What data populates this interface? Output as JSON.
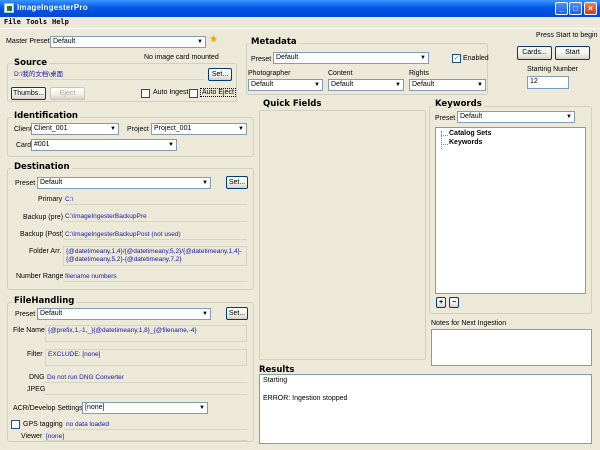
{
  "window": {
    "title": "ImageIngesterPro",
    "controls": {
      "minimize": "_",
      "maximize": "□",
      "close": "×"
    }
  },
  "menu": [
    "File",
    "Tools",
    "Help"
  ],
  "master_preset": {
    "label": "Master Preset",
    "value": "Default"
  },
  "source": {
    "header": "Source",
    "no_card_status": "No image card mounted",
    "path": "D:\\我的文档\\桌面",
    "set_button": "Set...",
    "thumbs_button": "Thumbs...",
    "eject_button": "Eject",
    "auto_ingest_label": "Auto Ingest",
    "auto_eject_label": "Auto Eject"
  },
  "identification": {
    "header": "Identification",
    "client_label": "Client",
    "client_value": "Client_001",
    "project_label": "Project",
    "project_value": "Project_001",
    "card_label": "Card",
    "card_value": "#001"
  },
  "destination": {
    "header": "Destination",
    "preset_label": "Preset",
    "preset_value": "Default",
    "set_button": "Set...",
    "primary_label": "Primary",
    "primary_value": "C:\\",
    "backup_pre_label": "Backup (pre)",
    "backup_pre_value": "C:\\ImageIngesterBackupPre",
    "backup_post_label": "Backup (Post)",
    "backup_post_value": "C:\\ImageIngesterBackupPost (not used)",
    "folder_arr_label": "Folder Arr.",
    "folder_arr_value": "{@datetimeany,1,4}/{@datetimeany,5,2}/{@datetimeany,1,4}-{@datetimeany,5,2}-{@datetimeany,7,2}",
    "number_range_label": "Number Range",
    "number_range_value": "filename numbers"
  },
  "file_handling": {
    "header": "FileHandling",
    "preset_label": "Preset",
    "preset_value": "Default",
    "set_button": "Set...",
    "file_name_label": "File Name",
    "file_name_value": "{@prefix,1,-1,_}{@datetimeany,1,8}_{@filename,-4}",
    "filter_label": "Filter",
    "filter_value": "EXCLUDE: [none]",
    "dng_label": "DNG",
    "dng_value": "Do not run DNG Converter",
    "jpeg_label": "JPEG",
    "jpeg_value": "",
    "acr_label": "ACR/Develop Settings",
    "acr_value": "[none]",
    "gps_label": "GPS tagging",
    "gps_value": "no data loaded",
    "viewer_label": "Viewer",
    "viewer_value": "[none]"
  },
  "metadata": {
    "header": "Metadata",
    "preset_label": "Preset",
    "preset_value": "Default",
    "enabled_label": "Enabled",
    "enabled_checked": true,
    "photographer_label": "Photographer",
    "photographer_value": "Default",
    "content_label": "Content",
    "content_value": "Default",
    "rights_label": "Rights",
    "rights_value": "Default"
  },
  "actions": {
    "press_start_text": "Press Start to begin",
    "cards_button": "Cards...",
    "start_button": "Start",
    "starting_number_label": "Starting Number",
    "starting_number_value": "12"
  },
  "quick_fields": {
    "header": "Quick Fields"
  },
  "keywords": {
    "header": "Keywords",
    "preset_label": "Preset",
    "preset_value": "Default",
    "tree_items": [
      "Catalog Sets",
      "Keywords"
    ],
    "add_button": "+",
    "remove_button": "−"
  },
  "notes": {
    "label": "Notes for Next Ingestion"
  },
  "results": {
    "header": "Results",
    "lines": [
      "Starting",
      "",
      "ERROR: Ingestion stopped"
    ]
  },
  "colors": {
    "titlebar": "#0058e6",
    "field_text": "#1515a8",
    "star": "#f5a400"
  },
  "icons": {
    "star": "★",
    "dropdown": "▼",
    "check": "✓"
  }
}
